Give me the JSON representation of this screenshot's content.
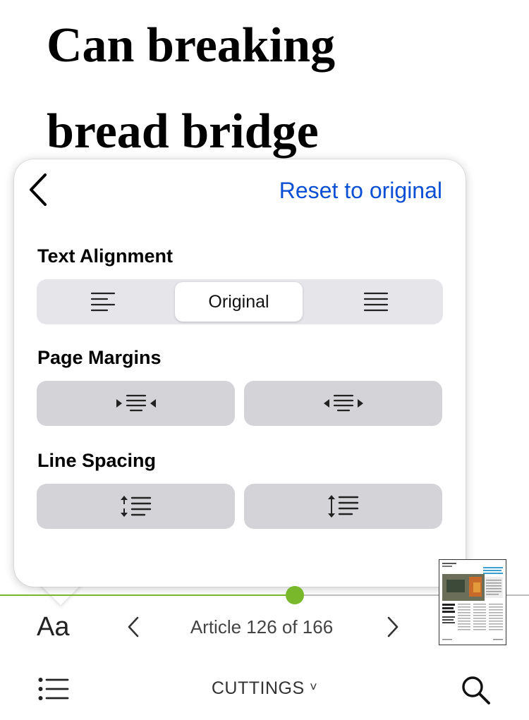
{
  "article": {
    "headline_line1": "Can breaking",
    "headline_line2": "bread bridge"
  },
  "popover": {
    "back_icon": "chevron-left-icon",
    "reset_label": "Reset to original",
    "text_alignment": {
      "title": "Text Alignment",
      "options": [
        {
          "icon": "align-left-icon",
          "label": ""
        },
        {
          "icon": "",
          "label": "Original"
        },
        {
          "icon": "align-justify-icon",
          "label": ""
        }
      ],
      "selected": "Original"
    },
    "page_margins": {
      "title": "Page Margins",
      "options": [
        {
          "icon": "decrease-margins-icon"
        },
        {
          "icon": "increase-margins-icon"
        }
      ]
    },
    "line_spacing": {
      "title": "Line Spacing",
      "options": [
        {
          "icon": "decrease-line-spacing-icon"
        },
        {
          "icon": "increase-line-spacing-icon"
        }
      ]
    }
  },
  "reader": {
    "progress_fraction": 0.557,
    "font_button_label": "Aa",
    "article_position": "Article 126 of 166",
    "section_label": "CUTTINGS",
    "section_chevron": "˅",
    "colors": {
      "accent_green": "#78b82a",
      "link_blue": "#0a4fd4"
    }
  }
}
